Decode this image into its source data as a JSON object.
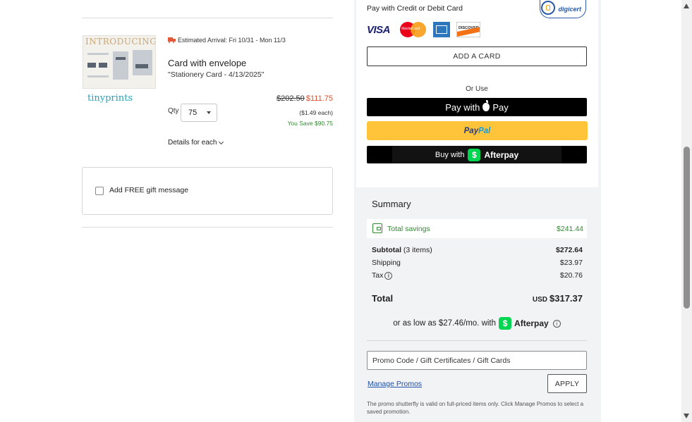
{
  "item": {
    "thumbnail_text": "INTRODUCING",
    "brand": "tinyprints",
    "arrival": "Estimated Arrival: Fri 10/31 - Mon 11/3",
    "title": "Card with envelope",
    "subtitle": "\"Stationery Card - 4/13/2025\"",
    "qty_label": "Qty",
    "qty_value": "75",
    "price_original": "$202.50",
    "price_sale": "$111.75",
    "price_each": "($1.49 each)",
    "savings": "You Save $90.75",
    "details_label": "Details for each"
  },
  "gift": {
    "label": "Add FREE gift message",
    "checked": false
  },
  "payment": {
    "title": "Pay with Credit or Debit Card",
    "trust_badge": "digicert",
    "card_brands": [
      "VISA",
      "MasterCard",
      "American Express",
      "DISCOVER"
    ],
    "visa_text": "VISA",
    "mastercard_text": "MasterCard",
    "discover_text": "DISCOVER",
    "add_card_label": "ADD A CARD",
    "or_use": "Or Use",
    "apple_pay_prefix": "Pay with",
    "apple_pay_suffix": "Pay",
    "paypal_part1": "Pay",
    "paypal_part2": "Pal",
    "afterpay_buy_with": "Buy with",
    "afterpay_name": "Afterpay"
  },
  "summary": {
    "title": "Summary",
    "total_savings_label": "Total savings",
    "total_savings_value": "$241.44",
    "subtotal_label": "Subtotal",
    "subtotal_items": "(3 items)",
    "subtotal_value": "$272.64",
    "shipping_label": "Shipping",
    "shipping_value": "$23.97",
    "tax_label": "Tax",
    "tax_value": "$20.76",
    "total_label": "Total",
    "total_currency": "USD",
    "total_value": "$317.37",
    "installment_text": "or as low as $27.46/mo. with",
    "installment_provider": "Afterpay"
  },
  "promo": {
    "placeholder": "Promo Code / Gift Certificates / Gift Cards",
    "value": "",
    "manage_label": "Manage Promos",
    "apply_label": "APPLY",
    "note": "The promo shutterfly is valid on full-priced items only. Click Manage Promos to select a saved promotion."
  },
  "colors": {
    "sale_price": "#d9502f",
    "savings_green": "#2f8a2f",
    "paypal_yellow": "#ffc43a",
    "afterpay_green": "#00d64f",
    "link_blue": "#1f4fa8",
    "brand_teal": "#2aa3b8"
  },
  "icons": [
    "truck-icon",
    "chevron-down-icon",
    "caret-down-icon",
    "digicert-icon",
    "apple-icon",
    "dollar-badge-icon",
    "wallet-icon",
    "info-icon"
  ]
}
